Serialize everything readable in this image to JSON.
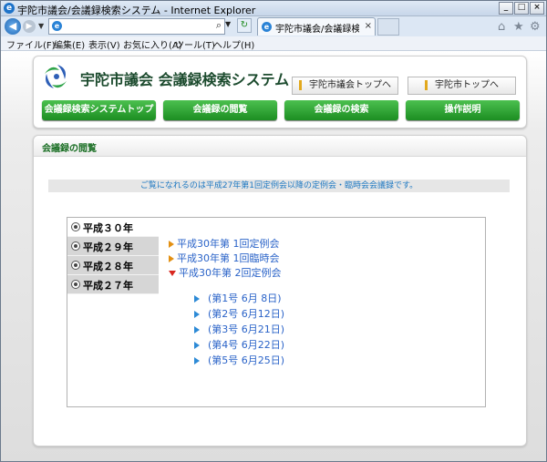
{
  "browser": {
    "title": "宇陀市議会/会議録検索システム - Internet Explorer",
    "tab_title": "宇陀市議会/会議録検索シ...",
    "menu": [
      "ファイル(F)",
      "編集(E)",
      "表示(V)",
      "お気に入り(A)",
      "ツール(T)",
      "ヘルプ(H)"
    ],
    "min_label": "_",
    "max_label": "□",
    "close_label": "×"
  },
  "site": {
    "title": "宇陀市議会 会議録検索システム",
    "top_links": [
      "宇陀市議会トップへ",
      "宇陀市トップへ"
    ],
    "nav": [
      "会議録検索システムトップ",
      "会議録の閲覧",
      "会議録の検索",
      "操作説明"
    ],
    "accent": "#1c8e22"
  },
  "section": {
    "title": "会議録の閲覧",
    "notice": "ご覧になれるのは平成27年第1回定例会以降の定例会・臨時会会議録です。"
  },
  "years": [
    {
      "label": "平成３０年",
      "selected": true
    },
    {
      "label": "平成２９年",
      "selected": false
    },
    {
      "label": "平成２８年",
      "selected": false
    },
    {
      "label": "平成２７年",
      "selected": false
    }
  ],
  "sessions": [
    {
      "label": "平成30年第 1回定例会",
      "expanded": false
    },
    {
      "label": "平成30年第 1回臨時会",
      "expanded": false
    },
    {
      "label": "平成30年第 2回定例会",
      "expanded": true
    }
  ],
  "issues": [
    "(第1号 6月 8日)",
    "(第2号 6月12日)",
    "(第3号 6月21日)",
    "(第4号 6月22日)",
    "(第5号 6月25日)"
  ]
}
